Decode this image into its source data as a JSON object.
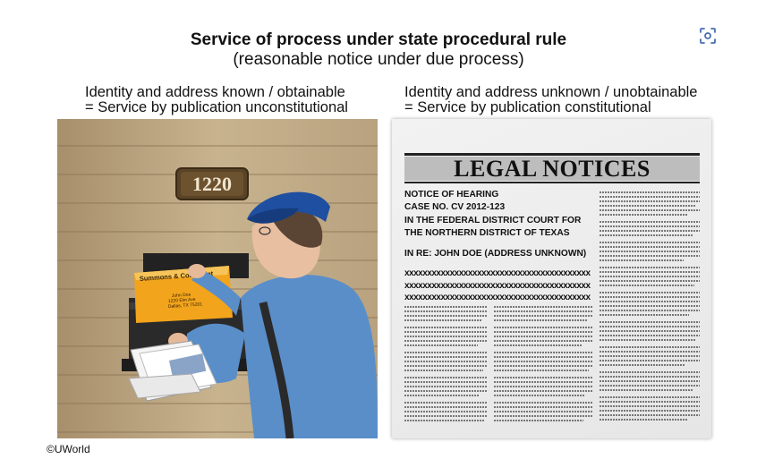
{
  "header": {
    "title": "Service of process under state procedural rule",
    "subtitle": "(reasonable notice under due process)"
  },
  "toolbar": {
    "focus_icon": "focus-scan-icon"
  },
  "left_panel": {
    "caption_line1": "Identity and address known / obtainable",
    "caption_line2": "= Service by publication unconstitutional",
    "house_number": "1220",
    "envelope_label": "Summons & Complaint",
    "envelope_addr1": "John Doe",
    "envelope_addr2": "1220 Elm Ave",
    "envelope_addr3": "Dallas, TX 75201"
  },
  "right_panel": {
    "caption_line1": "Identity and address unknown / unobtainable",
    "caption_line2": "= Service by publication constitutional",
    "banner": "LEGAL NOTICES",
    "notice_line1": "NOTICE OF HEARING",
    "notice_line2": "CASE NO. CV 2012-123",
    "notice_line3": "IN THE FEDERAL DISTRICT COURT FOR",
    "notice_line4": "THE NORTHERN DISTRICT OF TEXAS",
    "notice_line5": "IN RE: JOHN DOE (ADDRESS UNKNOWN)",
    "xline1": "xxxxxxxxxxxxxxxxxxxxxxxxxxxxxxxxxxxxxxxxx",
    "xline2": "xxxxxxxxxxxxxxxxxxxxxxxxxxxxxxxxxxxxxxxxx",
    "xline3": "xxxxxxxxxxxxxxxxxxxxxxxxxxxxxxxxxxxxxxxxx"
  },
  "footer": {
    "copyright": "©UWorld"
  },
  "colors": {
    "siding": "#c9b391",
    "uniform_blue": "#5a8ec9",
    "cap_blue": "#1f4fa0",
    "envelope": "#f2a41c"
  }
}
